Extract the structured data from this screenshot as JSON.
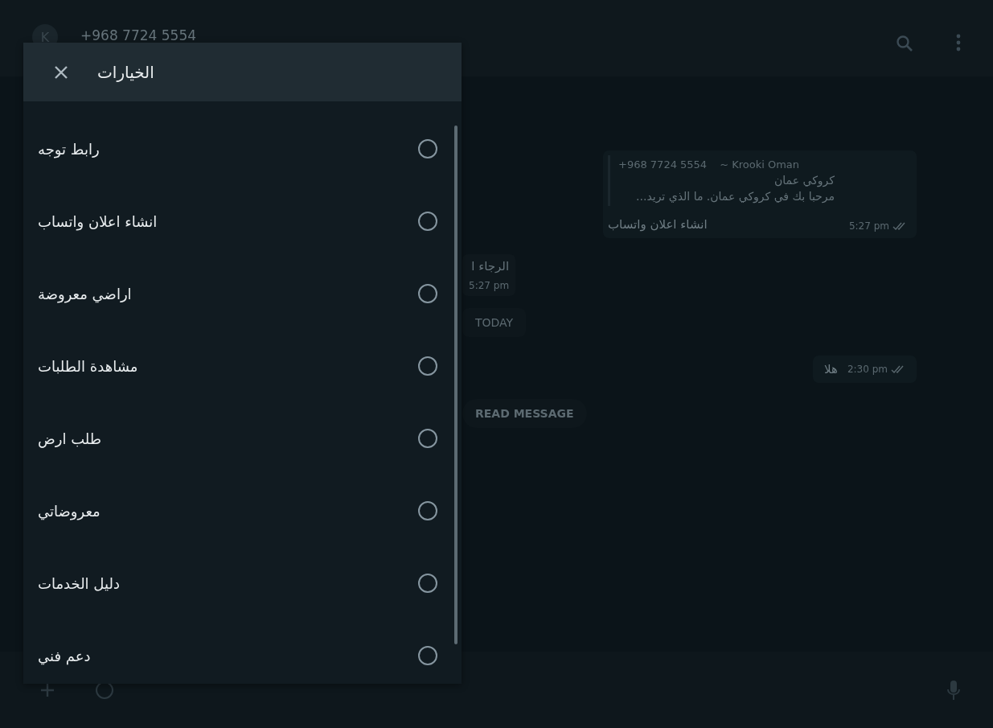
{
  "chat_header": {
    "avatar_letter": "K",
    "title": "+968 7724 5554"
  },
  "messages": [
    {
      "kind": "quoted",
      "quote_sender": "+968 7724 5554",
      "quote_name": "~ Krooki Oman",
      "quote_lines": [
        "كروكي عمان",
        "مرحبا بك في كروكي عمان. ما الذي تريد..."
      ],
      "text": "انشاء اعلان واتساب",
      "time": "5:27 pm",
      "read": true
    },
    {
      "kind": "incoming",
      "text": "الرجاء ا",
      "time": "5:27 pm"
    },
    {
      "kind": "pill",
      "text": "TODAY"
    },
    {
      "kind": "outgoing",
      "text": "هلا",
      "time": "2:30 pm",
      "read": true
    },
    {
      "kind": "pill",
      "text": "READ MESSAGE"
    }
  ],
  "dialog": {
    "title": "الخيارات",
    "options": [
      {
        "label": "رابط توجه",
        "selected": false
      },
      {
        "label": "انشاء اعلان واتساب",
        "selected": false
      },
      {
        "label": "اراضي معروضة",
        "selected": false
      },
      {
        "label": "مشاهدة الطلبات",
        "selected": false
      },
      {
        "label": "طلب ارض",
        "selected": false
      },
      {
        "label": "معروضاتي",
        "selected": false
      },
      {
        "label": "دليل الخدمات",
        "selected": false
      },
      {
        "label": "دعم فني",
        "selected": false
      }
    ]
  }
}
